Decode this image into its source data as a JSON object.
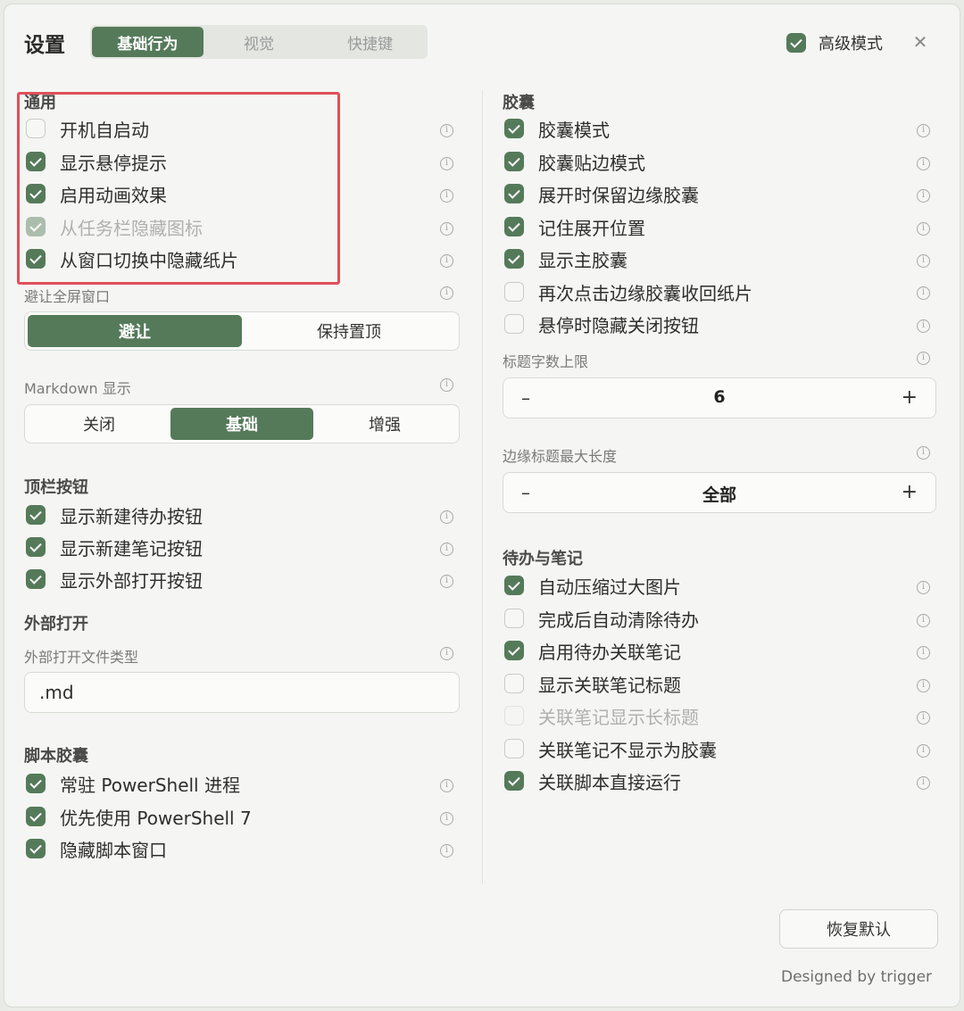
{
  "header": {
    "title": "设置",
    "tabs": [
      "基础行为",
      "视觉",
      "快捷键"
    ],
    "advanced_mode": "高级模式"
  },
  "left": {
    "general": {
      "title": "通用",
      "items": [
        {
          "label": "开机自启动",
          "checked": false
        },
        {
          "label": "显示悬停提示",
          "checked": true
        },
        {
          "label": "启用动画效果",
          "checked": true
        },
        {
          "label": "从任务栏隐藏图标",
          "checked": true,
          "disabled": true
        },
        {
          "label": "从窗口切换中隐藏纸片",
          "checked": true
        }
      ]
    },
    "avoid_fullscreen": {
      "label": "避让全屏窗口",
      "options": [
        "避让",
        "保持置顶"
      ],
      "selected": "避让"
    },
    "markdown": {
      "label": "Markdown 显示",
      "options": [
        "关闭",
        "基础",
        "增强"
      ],
      "selected": "基础"
    },
    "topbar": {
      "title": "顶栏按钮",
      "items": [
        {
          "label": "显示新建待办按钮",
          "checked": true
        },
        {
          "label": "显示新建笔记按钮",
          "checked": true
        },
        {
          "label": "显示外部打开按钮",
          "checked": true
        }
      ]
    },
    "external_open": {
      "title": "外部打开",
      "field_label": "外部打开文件类型",
      "field_value": ".md"
    },
    "script_capsule": {
      "title": "脚本胶囊",
      "items": [
        {
          "label": "常驻 PowerShell 进程",
          "checked": true
        },
        {
          "label": "优先使用 PowerShell 7",
          "checked": true
        },
        {
          "label": "隐藏脚本窗口",
          "checked": true
        }
      ]
    }
  },
  "right": {
    "capsule": {
      "title": "胶囊",
      "items": [
        {
          "label": "胶囊模式",
          "checked": true
        },
        {
          "label": "胶囊贴边模式",
          "checked": true
        },
        {
          "label": "展开时保留边缘胶囊",
          "checked": true
        },
        {
          "label": "记住展开位置",
          "checked": true
        },
        {
          "label": "显示主胶囊",
          "checked": true
        },
        {
          "label": "再次点击边缘胶囊收回纸片",
          "checked": false
        },
        {
          "label": "悬停时隐藏关闭按钮",
          "checked": false
        }
      ]
    },
    "title_limit": {
      "label": "标题字数上限",
      "value": "6",
      "minus": "–",
      "plus": "+"
    },
    "edge_title": {
      "label": "边缘标题最大长度",
      "value": "全部",
      "minus": "–",
      "plus": "+"
    },
    "todo_notes": {
      "title": "待办与笔记",
      "items": [
        {
          "label": "自动压缩过大图片",
          "checked": true
        },
        {
          "label": "完成后自动清除待办",
          "checked": false
        },
        {
          "label": "启用待办关联笔记",
          "checked": true
        },
        {
          "label": "显示关联笔记标题",
          "checked": false
        },
        {
          "label": "关联笔记显示长标题",
          "checked": false,
          "disabled": true
        },
        {
          "label": "关联笔记不显示为胶囊",
          "checked": false
        },
        {
          "label": "关联脚本直接运行",
          "checked": true
        }
      ]
    }
  },
  "footer": {
    "reset": "恢复默认",
    "designed_by": "Designed by trigger"
  },
  "colors": {
    "accent": "#557a5a",
    "highlight_box": "#e0505a"
  }
}
